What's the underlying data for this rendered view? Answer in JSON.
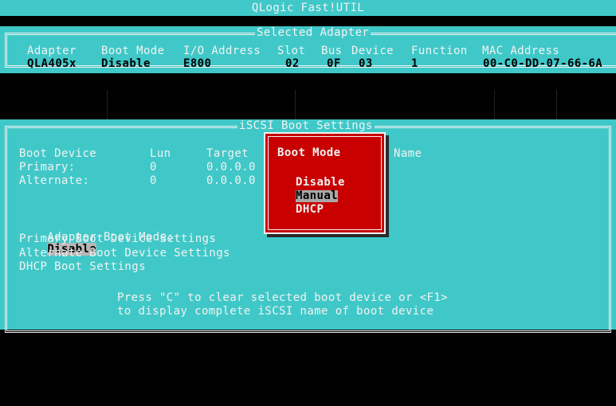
{
  "title": "QLogic Fast!UTIL",
  "selected_adapter": {
    "title": "Selected Adapter",
    "headers": [
      "Adapter",
      "Boot Mode",
      "I/O Address",
      "Slot",
      "Bus",
      "Device",
      "Function",
      "MAC Address"
    ],
    "row": [
      "QLA405x",
      "Disable",
      "E800",
      "02",
      "0F",
      "03",
      "1",
      "00-C0-DD-07-66-6A"
    ]
  },
  "iscsi": {
    "title": "iSCSI Boot Settings",
    "col_boot_device": "Boot Device",
    "col_lun": "Lun",
    "col_target": "Target",
    "col_name": "Name",
    "rows": [
      {
        "label": "Primary:",
        "lun": "0",
        "target": "0.0.0.0"
      },
      {
        "label": "Alternate:",
        "lun": "0",
        "target": "0.0.0.0"
      }
    ],
    "menu": {
      "adapter_boot_mode_label": "Adapter Boot Mode:",
      "adapter_boot_mode_value": "Disable",
      "primary": "Primary Boot Device Settings",
      "alternate": "Alternate Boot Device Settings",
      "dhcp": "DHCP Boot Settings"
    },
    "help_line1": "Press \"C\" to clear selected boot device or <F1>",
    "help_line2": "to display complete iSCSI name of boot device"
  },
  "popup": {
    "title": "Boot Mode",
    "options": [
      "Disable",
      "Manual",
      "DHCP"
    ],
    "selected": "Manual"
  },
  "colors": {
    "cyan": "#40c8c8",
    "red": "#c80000",
    "navy": "#0e1f6e",
    "white": "#f2f2f2"
  }
}
